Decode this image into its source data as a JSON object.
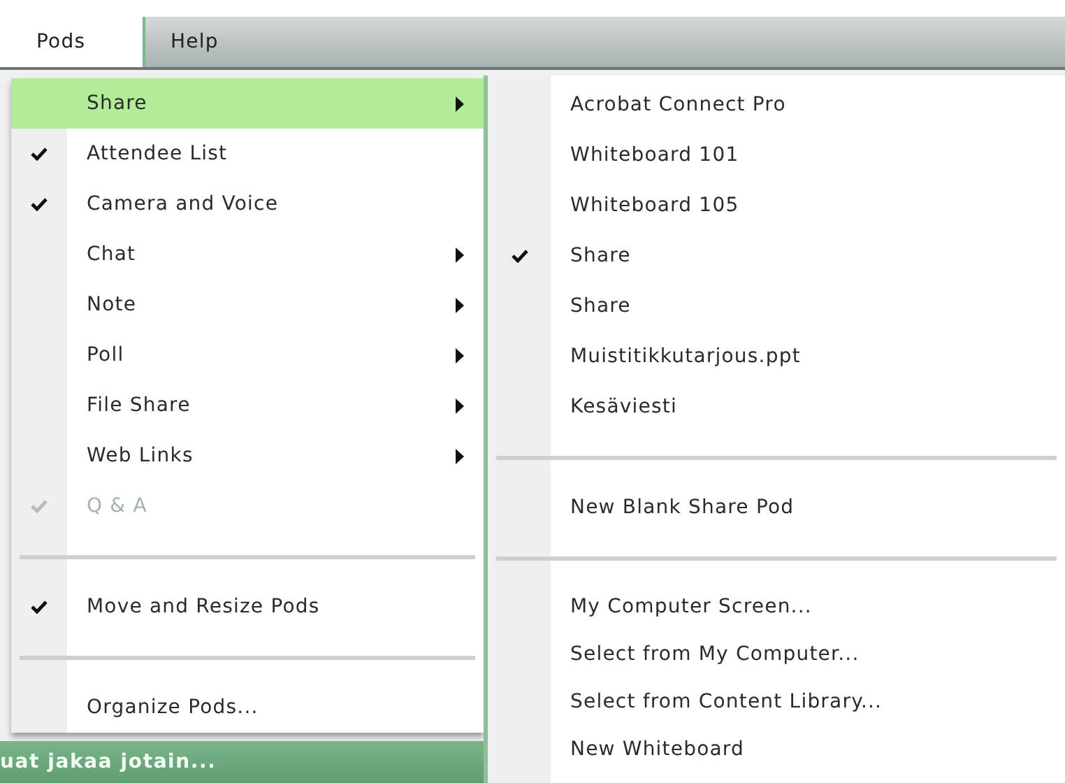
{
  "menubar": [
    {
      "label": "Pods",
      "selected": true
    },
    {
      "label": "Help",
      "selected": false
    }
  ],
  "menu": [
    {
      "kind": "item",
      "label": "Share",
      "checked": false,
      "disabled": false,
      "submenu": true,
      "selected": true
    },
    {
      "kind": "item",
      "label": "Attendee List",
      "checked": true,
      "disabled": false,
      "submenu": false,
      "selected": false
    },
    {
      "kind": "item",
      "label": "Camera and Voice",
      "checked": true,
      "disabled": false,
      "submenu": false,
      "selected": false
    },
    {
      "kind": "item",
      "label": "Chat",
      "checked": false,
      "disabled": false,
      "submenu": true,
      "selected": false
    },
    {
      "kind": "item",
      "label": "Note",
      "checked": false,
      "disabled": false,
      "submenu": true,
      "selected": false
    },
    {
      "kind": "item",
      "label": "Poll",
      "checked": false,
      "disabled": false,
      "submenu": true,
      "selected": false
    },
    {
      "kind": "item",
      "label": "File Share",
      "checked": false,
      "disabled": false,
      "submenu": true,
      "selected": false
    },
    {
      "kind": "item",
      "label": "Web Links",
      "checked": false,
      "disabled": false,
      "submenu": true,
      "selected": false
    },
    {
      "kind": "item",
      "label": "Q & A",
      "checked": true,
      "disabled": true,
      "submenu": false,
      "selected": false
    },
    {
      "kind": "separator"
    },
    {
      "kind": "item",
      "label": "Move and Resize Pods",
      "checked": true,
      "disabled": false,
      "submenu": false,
      "selected": false
    },
    {
      "kind": "separator"
    },
    {
      "kind": "item",
      "label": "Organize Pods...",
      "checked": false,
      "disabled": false,
      "submenu": false,
      "selected": false
    }
  ],
  "submenu": [
    {
      "kind": "item",
      "label": "Acrobat Connect Pro",
      "checked": false
    },
    {
      "kind": "item",
      "label": "Whiteboard 101",
      "checked": false
    },
    {
      "kind": "item",
      "label": "Whiteboard 105",
      "checked": false
    },
    {
      "kind": "item",
      "label": "Share",
      "checked": true
    },
    {
      "kind": "item",
      "label": "Share",
      "checked": false
    },
    {
      "kind": "item",
      "label": "Muistitikkutarjous.ppt",
      "checked": false
    },
    {
      "kind": "item",
      "label": "Kesäviesti",
      "checked": false
    },
    {
      "kind": "separator"
    },
    {
      "kind": "item",
      "label": "New Blank Share Pod",
      "checked": false
    },
    {
      "kind": "separator"
    },
    {
      "kind": "item",
      "label": "My Computer Screen...",
      "checked": false
    },
    {
      "kind": "item",
      "label": "Select from My Computer...",
      "checked": false
    },
    {
      "kind": "item",
      "label": "Select from Content Library...",
      "checked": false
    },
    {
      "kind": "item",
      "label": "New Whiteboard",
      "checked": false
    }
  ],
  "status_bar": {
    "text": "uat jakaa jotain..."
  }
}
